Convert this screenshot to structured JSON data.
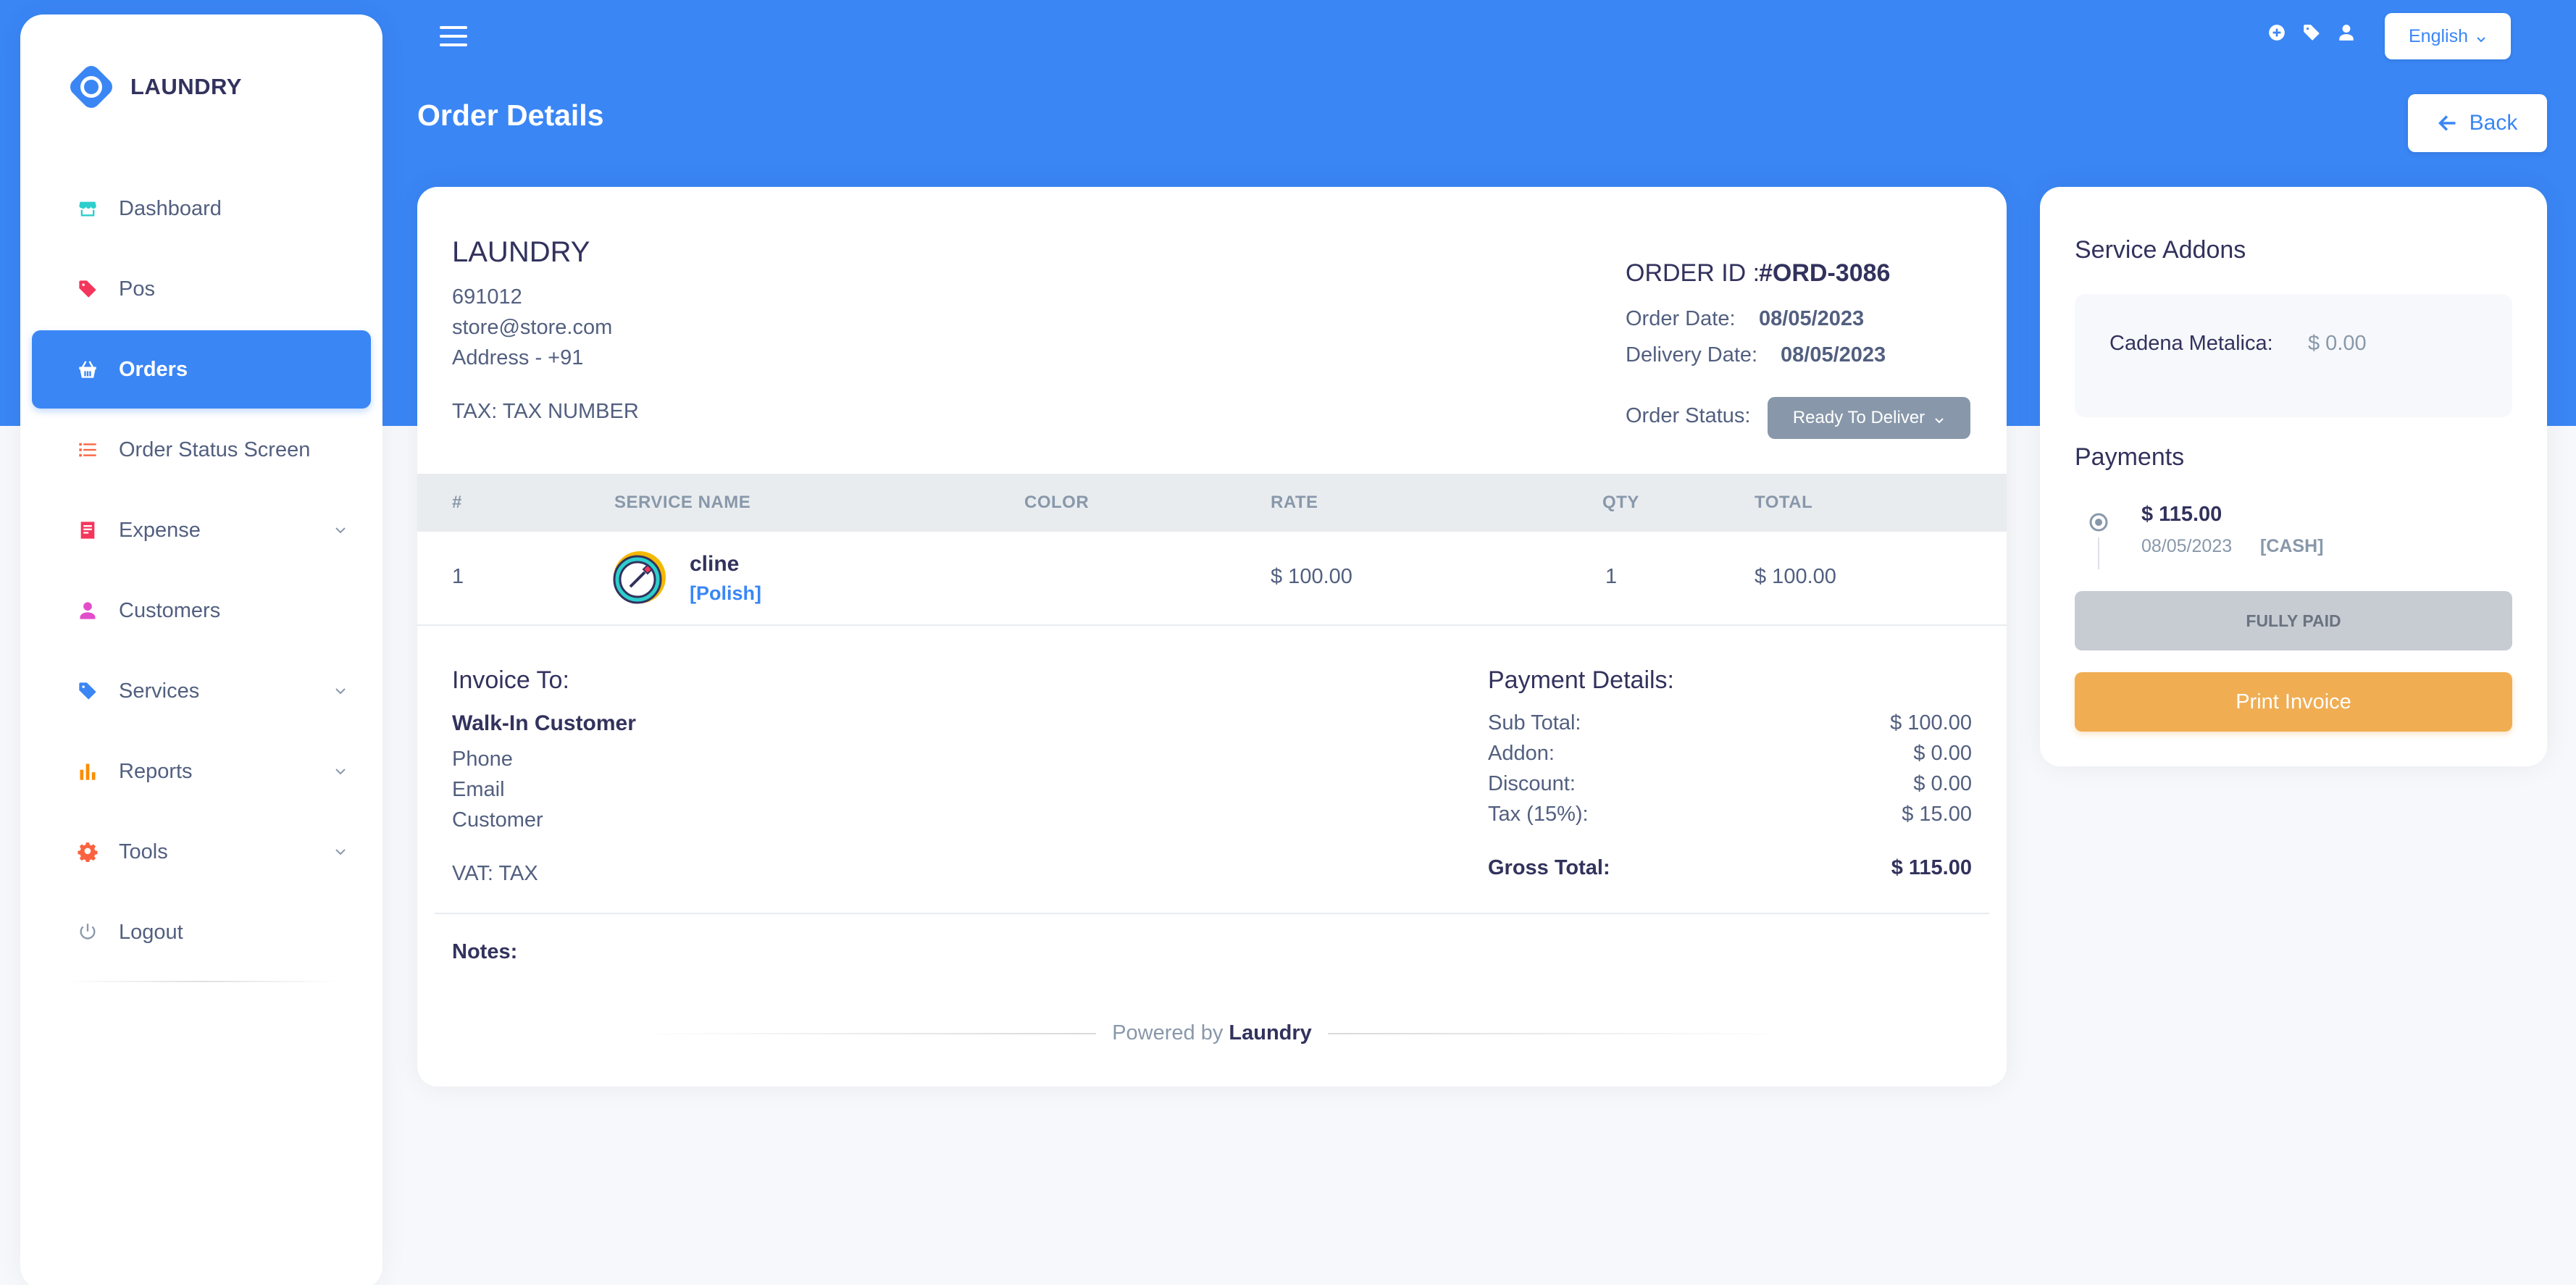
{
  "brand": {
    "name": "LAUNDRY",
    "color": "#3a86f5"
  },
  "sidebar": {
    "items": [
      {
        "label": "Dashboard",
        "icon": "store-icon"
      },
      {
        "label": "Pos",
        "icon": "tag-icon"
      },
      {
        "label": "Orders",
        "icon": "basket-icon",
        "active": true
      },
      {
        "label": "Order Status Screen",
        "icon": "list-icon"
      },
      {
        "label": "Expense",
        "icon": "receipt-icon",
        "expandable": true
      },
      {
        "label": "Customers",
        "icon": "user-icon"
      },
      {
        "label": "Services",
        "icon": "tag-icon",
        "expandable": true
      },
      {
        "label": "Reports",
        "icon": "bar-chart-icon",
        "expandable": true
      },
      {
        "label": "Tools",
        "icon": "gear-icon",
        "expandable": true
      },
      {
        "label": "Logout",
        "icon": "power-icon"
      }
    ]
  },
  "header": {
    "language": "English",
    "title": "Order Details",
    "back_label": "Back"
  },
  "store": {
    "name": "LAUNDRY",
    "phone": "691012",
    "email": "store@store.com",
    "address": "Address - +91",
    "tax": "TAX: TAX NUMBER"
  },
  "order": {
    "id_label": "ORDER ID :",
    "id": "#ORD-3086",
    "order_date_label": "Order Date:",
    "order_date": "08/05/2023",
    "delivery_date_label": "Delivery Date:",
    "delivery_date": "08/05/2023",
    "status_label": "Order Status:",
    "status": "Ready To Deliver"
  },
  "table": {
    "headers": {
      "num": "#",
      "service": "SERVICE NAME",
      "color": "COLOR",
      "rate": "RATE",
      "qty": "QTY",
      "total": "TOTAL"
    },
    "rows": [
      {
        "num": "1",
        "service": "cline",
        "addon": "[Polish]",
        "color": "",
        "rate": "$ 100.00",
        "qty": "1",
        "total": "$ 100.00"
      }
    ]
  },
  "invoice": {
    "title": "Invoice To:",
    "customer": "Walk-In Customer",
    "phone": "Phone",
    "email": "Email",
    "customer_label": "Customer",
    "vat": "VAT: TAX"
  },
  "payment": {
    "title": "Payment Details:",
    "sub_total_label": "Sub Total:",
    "sub_total": "$ 100.00",
    "addon_label": "Addon:",
    "addon": "$ 0.00",
    "discount_label": "Discount:",
    "discount": "$ 0.00",
    "tax_label": "Tax (15%):",
    "tax": "$ 15.00",
    "gross_label": "Gross Total:",
    "gross": "$ 115.00"
  },
  "notes_label": "Notes:",
  "powered": {
    "prefix": "Powered by",
    "brand": "Laundry"
  },
  "side": {
    "addons_title": "Service Addons",
    "addon_name": "Cadena Metalica:",
    "addon_price": "$ 0.00",
    "payments_title": "Payments",
    "payment_amount": "$ 115.00",
    "payment_date": "08/05/2023",
    "payment_type": "[CASH]",
    "fully_paid": "FULLY PAID",
    "print_label": "Print Invoice"
  }
}
